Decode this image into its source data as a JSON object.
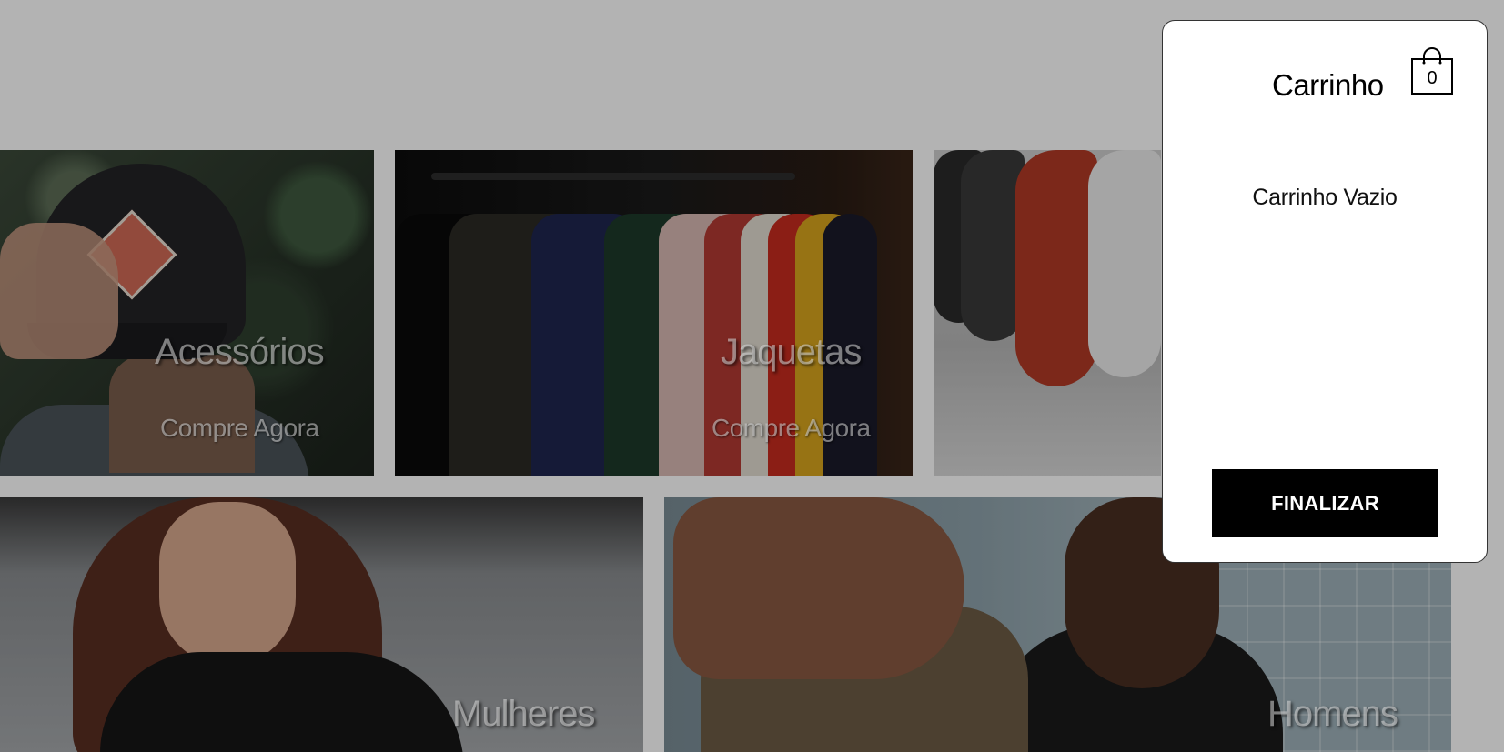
{
  "categories": {
    "acessorios": {
      "title": "Acessórios",
      "cta": "Compre Agora"
    },
    "jaquetas": {
      "title": "Jaquetas",
      "cta": "Compre Agora"
    },
    "tenis": {
      "title": ""
    },
    "mulheres": {
      "title": "Mulheres"
    },
    "homens": {
      "title": "Homens"
    }
  },
  "cart": {
    "title": "Carrinho",
    "count": "0",
    "empty_message": "Carrinho Vazio",
    "finalize_label": "FINALIZAR"
  },
  "icons": {
    "cart": "shopping-bag-icon"
  },
  "colors": {
    "overlay_background": "#b3b3b3",
    "panel_background": "#ffffff",
    "button_background": "#000000",
    "button_text": "#ffffff"
  }
}
